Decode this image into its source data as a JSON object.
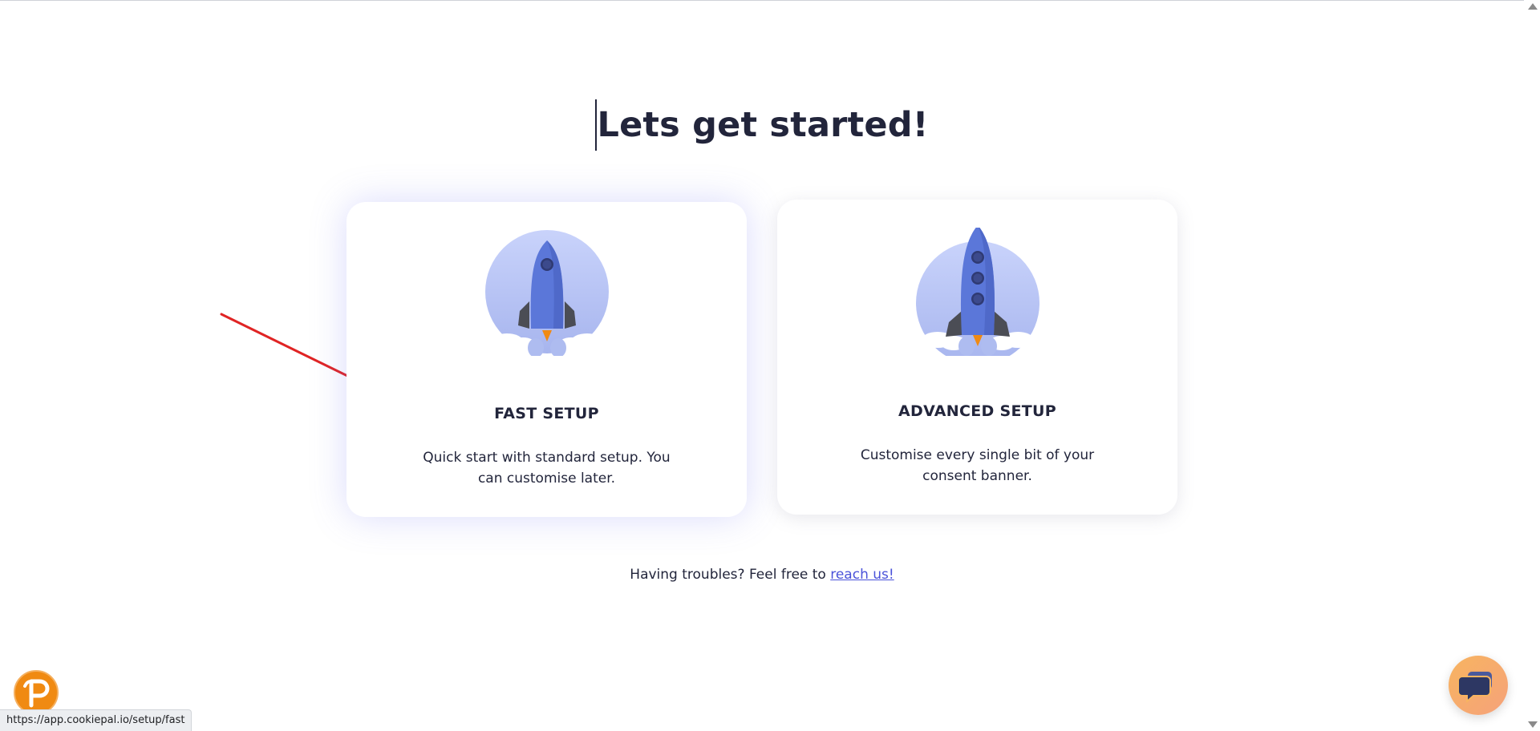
{
  "page": {
    "title": "Lets get started!"
  },
  "cards": {
    "fast": {
      "title": "FAST SETUP",
      "description": "Quick start with standard setup. You can customise later."
    },
    "advanced": {
      "title": "ADVANCED SETUP",
      "description": "Customise every single bit of your consent banner."
    }
  },
  "help": {
    "text": "Having troubles? Feel free to ",
    "link_label": "reach us!"
  },
  "status_bar": {
    "url": "https://app.cookiepal.io/setup/fast"
  },
  "icons": {
    "fast_illustration": "rocket-small-icon",
    "advanced_illustration": "rocket-large-icon",
    "brand_badge": "cookiepal-p-icon",
    "chat": "chat-bubbles-icon",
    "annotation": "red-arrow-icon"
  },
  "colors": {
    "text": "#22253b",
    "link": "#4a52d9",
    "rocket_body": "#5b77d9",
    "rocket_circle": "#b3c0f2",
    "annotation_arrow": "#e02424",
    "brand_orange": "#f08a12"
  }
}
